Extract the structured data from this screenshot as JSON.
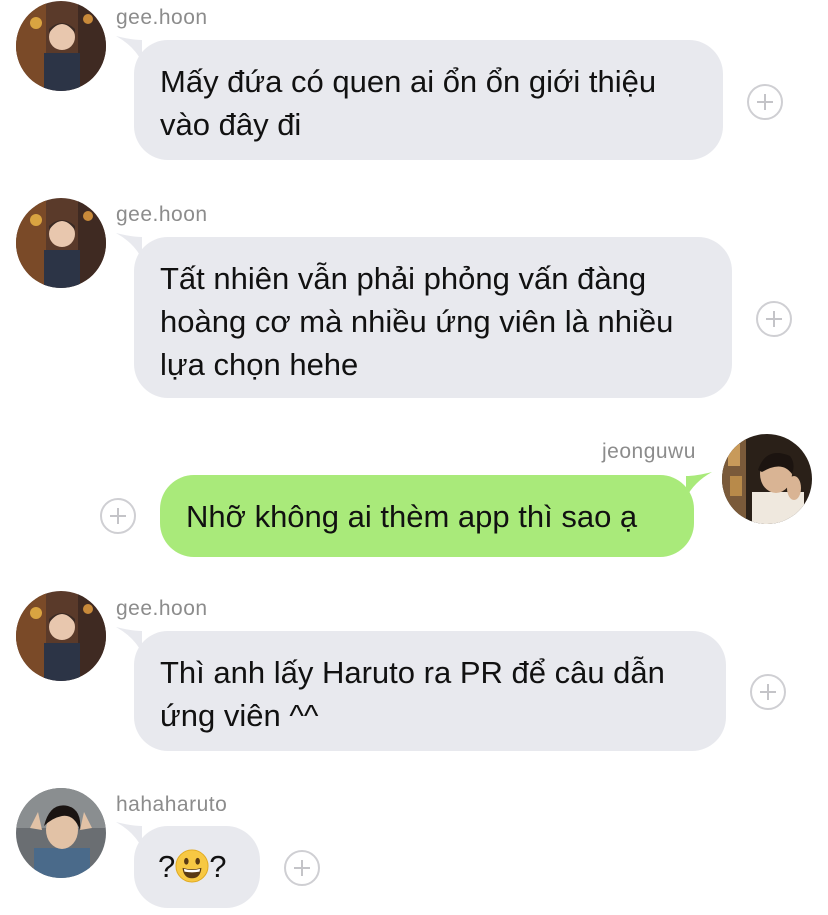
{
  "messages": [
    {
      "user": "gee.hoon",
      "text": "Mấy đứa có quen ai ổn ổn giới thiệu vào đây đi",
      "line1": "Mấy đứa có quen ai ổn ổn giới thiệu",
      "line2": "vào đây đi"
    },
    {
      "user": "gee.hoon",
      "line1": "Tất nhiên vẫn phải phỏng vấn đàng",
      "line2": "hoàng cơ mà nhiều ứng viên là nhiều",
      "line3": "lựa chọn hehe"
    },
    {
      "user": "jeonguwu",
      "line1": "Nhỡ không ai thèm app thì sao ạ"
    },
    {
      "user": "gee.hoon",
      "line1": "Thì anh lấy Haruto ra PR để câu dẫn",
      "line2": "ứng viên ^^"
    },
    {
      "user": "hahaharuto",
      "pre": "?",
      "emoji": "grinning-face",
      "post": "?"
    }
  ],
  "colors": {
    "bubble_incoming": "#e8e9ee",
    "bubble_outgoing": "#a9ea7a",
    "username": "#8c8c8c"
  }
}
